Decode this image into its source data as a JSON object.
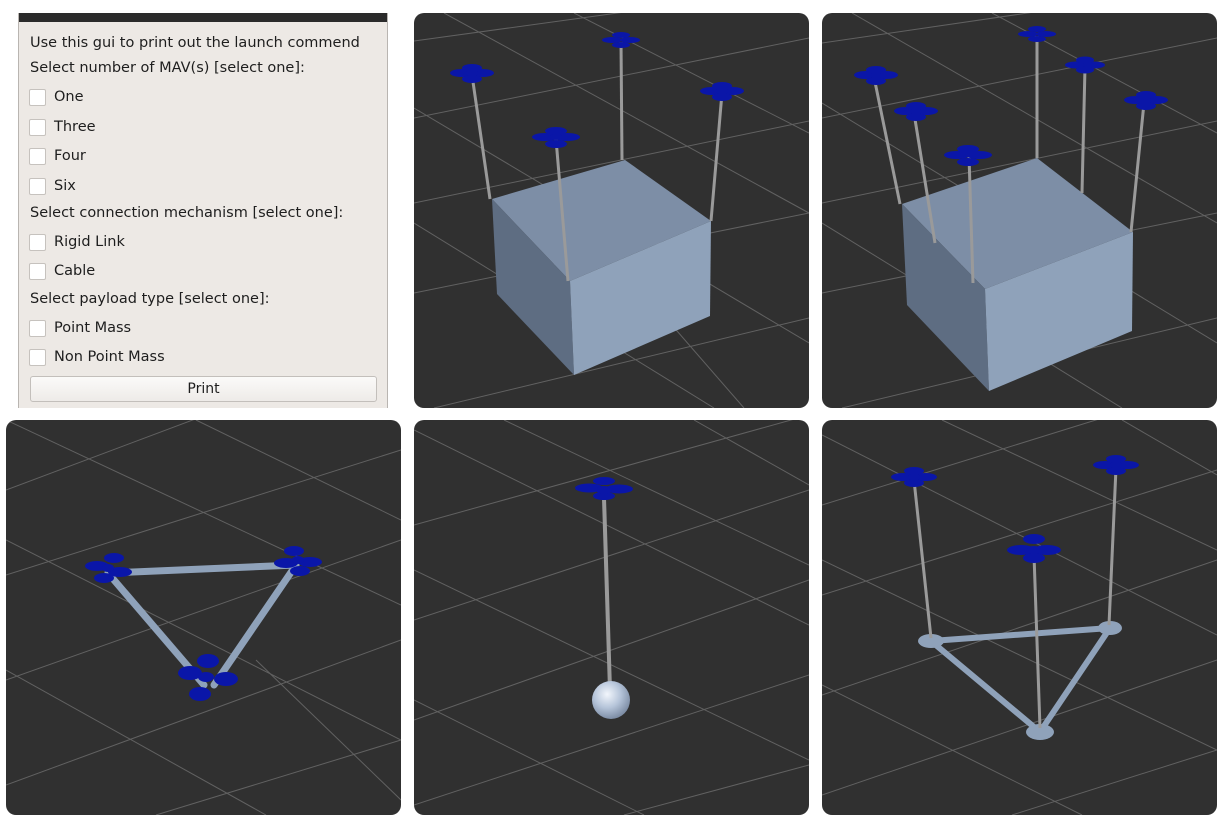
{
  "gui": {
    "instruction": "Use this gui to print out the launch commend",
    "mav_section": {
      "heading": "Select number of MAV(s) [select one]:",
      "options": [
        {
          "label": "One",
          "checked": false
        },
        {
          "label": "Three",
          "checked": false
        },
        {
          "label": "Four",
          "checked": false
        },
        {
          "label": "Six",
          "checked": false
        }
      ]
    },
    "connection_section": {
      "heading": "Select connection mechanism [select one]:",
      "options": [
        {
          "label": "Rigid Link",
          "checked": false
        },
        {
          "label": "Cable",
          "checked": false
        }
      ]
    },
    "payload_section": {
      "heading": "Select payload type [select one]:",
      "options": [
        {
          "label": "Point Mass",
          "checked": false
        },
        {
          "label": "Non Point Mass",
          "checked": false
        }
      ]
    },
    "print_label": "Print"
  },
  "scenes": [
    {
      "mav_count": 4,
      "connection": "cable",
      "payload": "cube"
    },
    {
      "mav_count": 6,
      "connection": "cable",
      "payload": "cube"
    },
    {
      "mav_count": 3,
      "connection": "rigid link",
      "payload": "triangle frame"
    },
    {
      "mav_count": 1,
      "connection": "cable",
      "payload": "sphere"
    },
    {
      "mav_count": 3,
      "connection": "cable",
      "payload": "triangle frame"
    }
  ],
  "colors": {
    "viewport_bg": "#303030",
    "grid_line": "#8a8a8a",
    "drone": "#0a16a8",
    "cable": "#9a9a9a",
    "payload": "#8fa2ba",
    "gui_bg": "#ede9e5"
  }
}
